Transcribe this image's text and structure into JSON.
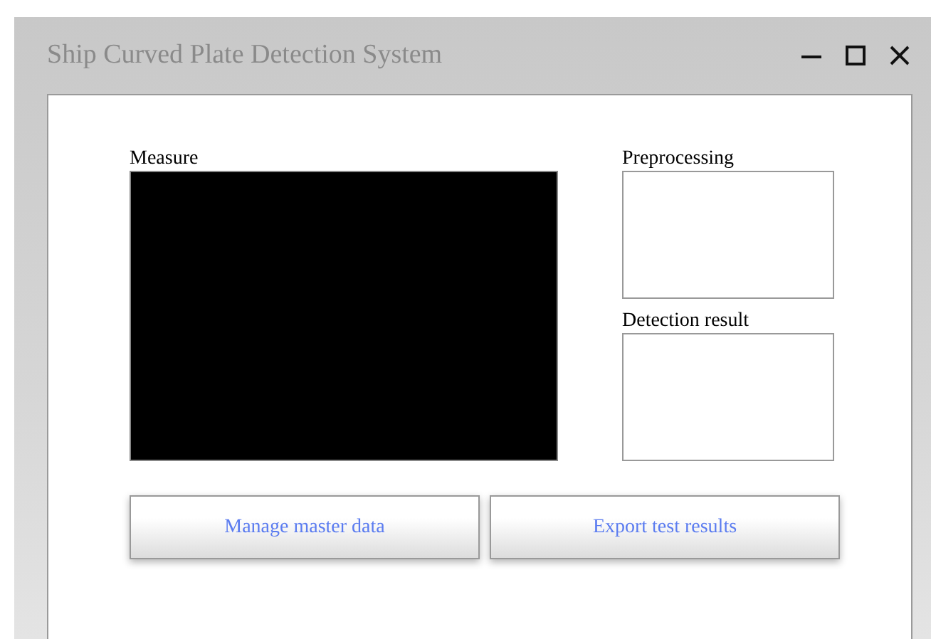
{
  "window": {
    "title": "Ship Curved Plate Detection System"
  },
  "panels": {
    "measure": {
      "label": "Measure"
    },
    "preprocessing": {
      "label": "Preprocessing"
    },
    "detection_result": {
      "label": "Detection result"
    }
  },
  "buttons": [
    {
      "label": "Manage master data"
    },
    {
      "label": "Export test results"
    }
  ]
}
